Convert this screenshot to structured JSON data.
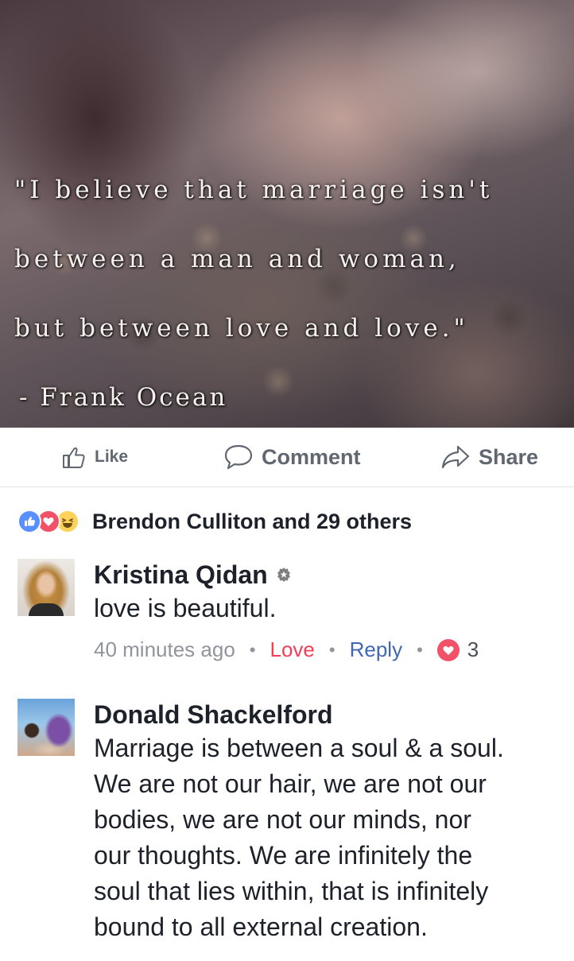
{
  "post": {
    "image": {
      "quote_lines": [
        "\"I believe that marriage isn't",
        "between a man and woman,",
        "but between love and love.\""
      ],
      "author": "- Frank Ocean"
    },
    "actions": {
      "like_label": "Like",
      "comment_label": "Comment",
      "share_label": "Share"
    },
    "reactions": {
      "types": [
        "like",
        "love",
        "haha"
      ],
      "summary": "Brendon Culliton and 29 others"
    }
  },
  "comments": [
    {
      "author": "Kristina Qidan",
      "badge_icon": "top-fan-badge-icon",
      "text": "love is beautiful.",
      "timestamp": "40 minutes ago",
      "love_label": "Love",
      "reply_label": "Reply",
      "reaction_count": "3"
    },
    {
      "author": "Donald Shackelford",
      "text_lines": [
        "Marriage is between a soul & a soul.",
        "We are not our hair, we are not our",
        "bodies,  we are not our minds, nor",
        "our thoughts.  We are infinitely the",
        "soul that  lies within, that is infinitely",
        "bound to all external creation."
      ]
    }
  ],
  "colors": {
    "name_text": "#1d2129",
    "meta_grey": "#90949c",
    "love_red": "#f33e58",
    "reply_blue": "#4267b2",
    "like_blue": "#5890ff"
  }
}
